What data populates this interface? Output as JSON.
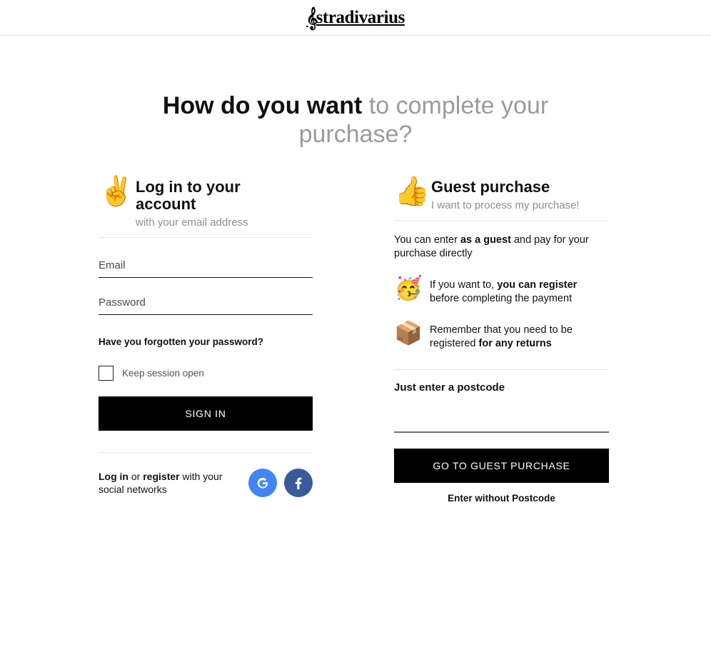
{
  "header": {
    "brand_clef": "𝄞",
    "brand_name": "stradivarius"
  },
  "page_title": {
    "strong": "How do you want",
    "rest": " to complete your purchase?"
  },
  "login": {
    "icon": "victory-hand-emoji",
    "icon_glyph": "✌️",
    "title": "Log in to your account",
    "subtitle": "with your email address",
    "email": {
      "label": "Email",
      "placeholder": "Email",
      "value": ""
    },
    "password": {
      "label": "Password",
      "placeholder": "Password",
      "value": ""
    },
    "forgot_password": "Have you forgotten your password?",
    "keep_session": {
      "label": "Keep session open",
      "checked": false
    },
    "sign_in_button": "SIGN IN",
    "social": {
      "text_login": "Log in",
      "text_or": " or ",
      "text_register": "register",
      "text_rest": " with your social networks",
      "google_label": "G",
      "google_color": "#4285f4",
      "facebook_label": "f",
      "facebook_color": "#3b5a9b"
    }
  },
  "guest": {
    "icon": "thumbs-up-emoji",
    "icon_glyph": "👍",
    "title": "Guest purchase",
    "subtitle": "I want to process my purchase!",
    "intro": {
      "pre": "You can enter ",
      "strong": "as a guest",
      "post": " and pay for your purchase directly"
    },
    "bullets": [
      {
        "icon": "partying-face-emoji",
        "icon_glyph": "🥳",
        "pre": "If you want to, ",
        "strong": "you can register",
        "post": " before completing the payment"
      },
      {
        "icon": "package-emoji",
        "icon_glyph": "📦",
        "pre": "Remember that you need to be registered ",
        "strong": "for any returns",
        "post": ""
      }
    ],
    "postcode_title": "Just enter a postcode",
    "postcode": {
      "placeholder": "",
      "value": ""
    },
    "guest_button": "GO TO GUEST PURCHASE",
    "no_postcode_link": "Enter without Postcode"
  }
}
